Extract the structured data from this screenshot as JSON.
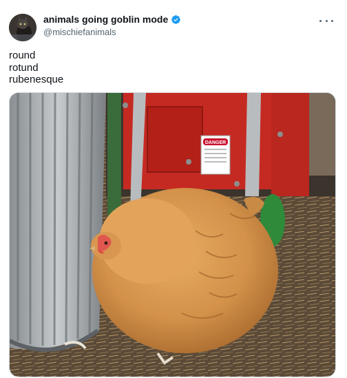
{
  "tweet": {
    "display_name": "animals going goblin mode",
    "handle": "@mischiefanimals",
    "verified": true,
    "more_icon": "more-horizontal-icon",
    "text_lines": [
      "round",
      "rotund",
      "rubenesque"
    ]
  },
  "media": {
    "sign_text": "DANGER",
    "subject": "chicken"
  },
  "colors": {
    "verified_blue": "#1d9bf0",
    "text": "#0f1419",
    "secondary": "#536471",
    "machine_red": "#c52a22",
    "chicken_orange": "#d3914a"
  }
}
